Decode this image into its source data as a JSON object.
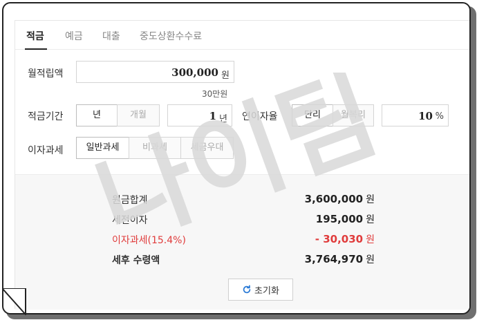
{
  "tabs": [
    "적금",
    "예금",
    "대출",
    "중도상환수수료"
  ],
  "form": {
    "monthly_deposit_label": "월적립액",
    "monthly_deposit_value": "300,000",
    "monthly_deposit_unit": "원",
    "monthly_deposit_hint": "30만원",
    "period_label": "적금기간",
    "period_unit_options": [
      "년",
      "개월"
    ],
    "period_unit_selected": "년",
    "period_value": "1",
    "period_value_unit": "년",
    "rate_label": "연이자율",
    "rate_type_options": [
      "단리",
      "월복리"
    ],
    "rate_type_selected": "단리",
    "rate_value": "10",
    "rate_unit": "%",
    "tax_label": "이자과세",
    "tax_options": [
      "일반과세",
      "비과세",
      "세금우대"
    ],
    "tax_selected": "일반과세"
  },
  "result": {
    "principal_label": "원금합계",
    "principal_value": "3,600,000",
    "pretax_interest_label": "세전이자",
    "pretax_interest_value": "195,000",
    "tax_label": "이자과세(15.4%)",
    "tax_value": "- 30,030",
    "net_label": "세후 수령액",
    "net_value": "3,764,970",
    "unit": "원"
  },
  "reset_label": "초기화",
  "watermark_text": "나이팀",
  "colors": {
    "accent_red": "#e03c3c",
    "reset_icon": "#2b7bd6",
    "watermark": "#d9d9d9"
  }
}
